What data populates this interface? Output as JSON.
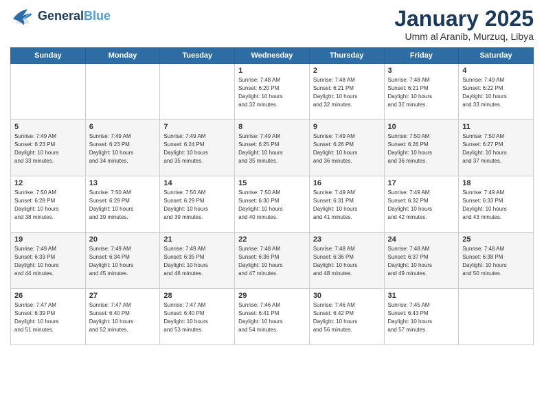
{
  "header": {
    "logo_general": "General",
    "logo_blue": "Blue",
    "month_title": "January 2025",
    "location": "Umm al Aranib, Murzuq, Libya"
  },
  "days_of_week": [
    "Sunday",
    "Monday",
    "Tuesday",
    "Wednesday",
    "Thursday",
    "Friday",
    "Saturday"
  ],
  "weeks": [
    [
      {
        "day": "",
        "info": ""
      },
      {
        "day": "",
        "info": ""
      },
      {
        "day": "",
        "info": ""
      },
      {
        "day": "1",
        "info": "Sunrise: 7:48 AM\nSunset: 6:20 PM\nDaylight: 10 hours\nand 32 minutes."
      },
      {
        "day": "2",
        "info": "Sunrise: 7:48 AM\nSunset: 6:21 PM\nDaylight: 10 hours\nand 32 minutes."
      },
      {
        "day": "3",
        "info": "Sunrise: 7:48 AM\nSunset: 6:21 PM\nDaylight: 10 hours\nand 32 minutes."
      },
      {
        "day": "4",
        "info": "Sunrise: 7:49 AM\nSunset: 6:22 PM\nDaylight: 10 hours\nand 33 minutes."
      }
    ],
    [
      {
        "day": "5",
        "info": "Sunrise: 7:49 AM\nSunset: 6:23 PM\nDaylight: 10 hours\nand 33 minutes."
      },
      {
        "day": "6",
        "info": "Sunrise: 7:49 AM\nSunset: 6:23 PM\nDaylight: 10 hours\nand 34 minutes."
      },
      {
        "day": "7",
        "info": "Sunrise: 7:49 AM\nSunset: 6:24 PM\nDaylight: 10 hours\nand 35 minutes."
      },
      {
        "day": "8",
        "info": "Sunrise: 7:49 AM\nSunset: 6:25 PM\nDaylight: 10 hours\nand 35 minutes."
      },
      {
        "day": "9",
        "info": "Sunrise: 7:49 AM\nSunset: 6:26 PM\nDaylight: 10 hours\nand 36 minutes."
      },
      {
        "day": "10",
        "info": "Sunrise: 7:50 AM\nSunset: 6:26 PM\nDaylight: 10 hours\nand 36 minutes."
      },
      {
        "day": "11",
        "info": "Sunrise: 7:50 AM\nSunset: 6:27 PM\nDaylight: 10 hours\nand 37 minutes."
      }
    ],
    [
      {
        "day": "12",
        "info": "Sunrise: 7:50 AM\nSunset: 6:28 PM\nDaylight: 10 hours\nand 38 minutes."
      },
      {
        "day": "13",
        "info": "Sunrise: 7:50 AM\nSunset: 6:29 PM\nDaylight: 10 hours\nand 39 minutes."
      },
      {
        "day": "14",
        "info": "Sunrise: 7:50 AM\nSunset: 6:29 PM\nDaylight: 10 hours\nand 39 minutes."
      },
      {
        "day": "15",
        "info": "Sunrise: 7:50 AM\nSunset: 6:30 PM\nDaylight: 10 hours\nand 40 minutes."
      },
      {
        "day": "16",
        "info": "Sunrise: 7:49 AM\nSunset: 6:31 PM\nDaylight: 10 hours\nand 41 minutes."
      },
      {
        "day": "17",
        "info": "Sunrise: 7:49 AM\nSunset: 6:32 PM\nDaylight: 10 hours\nand 42 minutes."
      },
      {
        "day": "18",
        "info": "Sunrise: 7:49 AM\nSunset: 6:33 PM\nDaylight: 10 hours\nand 43 minutes."
      }
    ],
    [
      {
        "day": "19",
        "info": "Sunrise: 7:49 AM\nSunset: 6:33 PM\nDaylight: 10 hours\nand 44 minutes."
      },
      {
        "day": "20",
        "info": "Sunrise: 7:49 AM\nSunset: 6:34 PM\nDaylight: 10 hours\nand 45 minutes."
      },
      {
        "day": "21",
        "info": "Sunrise: 7:49 AM\nSunset: 6:35 PM\nDaylight: 10 hours\nand 46 minutes."
      },
      {
        "day": "22",
        "info": "Sunrise: 7:48 AM\nSunset: 6:36 PM\nDaylight: 10 hours\nand 47 minutes."
      },
      {
        "day": "23",
        "info": "Sunrise: 7:48 AM\nSunset: 6:36 PM\nDaylight: 10 hours\nand 48 minutes."
      },
      {
        "day": "24",
        "info": "Sunrise: 7:48 AM\nSunset: 6:37 PM\nDaylight: 10 hours\nand 49 minutes."
      },
      {
        "day": "25",
        "info": "Sunrise: 7:48 AM\nSunset: 6:38 PM\nDaylight: 10 hours\nand 50 minutes."
      }
    ],
    [
      {
        "day": "26",
        "info": "Sunrise: 7:47 AM\nSunset: 6:39 PM\nDaylight: 10 hours\nand 51 minutes."
      },
      {
        "day": "27",
        "info": "Sunrise: 7:47 AM\nSunset: 6:40 PM\nDaylight: 10 hours\nand 52 minutes."
      },
      {
        "day": "28",
        "info": "Sunrise: 7:47 AM\nSunset: 6:40 PM\nDaylight: 10 hours\nand 53 minutes."
      },
      {
        "day": "29",
        "info": "Sunrise: 7:46 AM\nSunset: 6:41 PM\nDaylight: 10 hours\nand 54 minutes."
      },
      {
        "day": "30",
        "info": "Sunrise: 7:46 AM\nSunset: 6:42 PM\nDaylight: 10 hours\nand 56 minutes."
      },
      {
        "day": "31",
        "info": "Sunrise: 7:45 AM\nSunset: 6:43 PM\nDaylight: 10 hours\nand 57 minutes."
      },
      {
        "day": "",
        "info": ""
      }
    ]
  ]
}
